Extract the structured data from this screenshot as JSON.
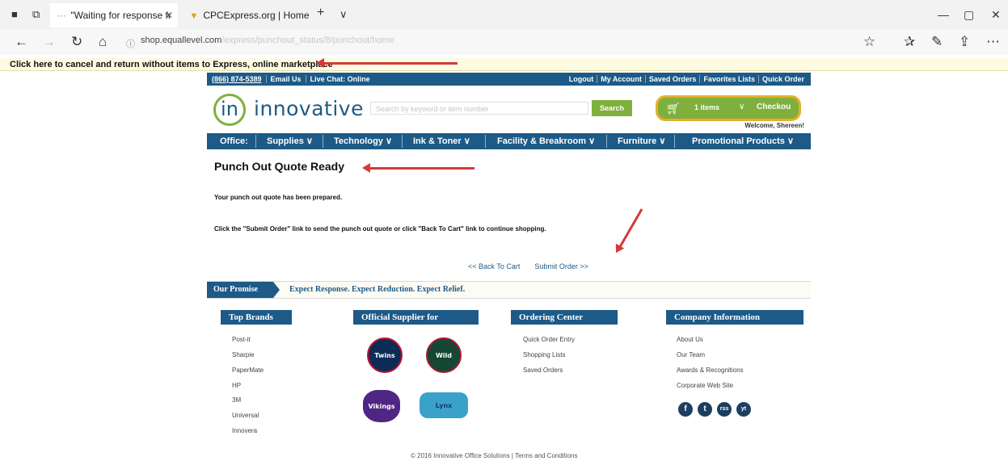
{
  "browser": {
    "tabs": [
      {
        "label": "\"Waiting for response fr",
        "active": true
      },
      {
        "label": "CPCExpress.org | Home",
        "active": false
      }
    ],
    "new_tab": "+",
    "tab_menu": "∨",
    "url_host": "shop.equallevel.com",
    "url_path": "/express/punchout_status/8/punchout/home",
    "infobar_text": "Click here to cancel and return without items to Express, online marketplace"
  },
  "site": {
    "phone": "(866) 874-5389",
    "top_left_links": [
      "Email Us",
      "Live Chat: Online"
    ],
    "top_right_links": [
      "Logout",
      "My Account",
      "Saved Orders",
      "Favorites Lists",
      "Quick Order"
    ],
    "logo_mark": "in",
    "logo_text": "innovative",
    "search_placeholder": "Search by keyword or item number",
    "search_button": "Search",
    "cart_items": "1 items",
    "checkout": "Checkou",
    "welcome": "Welcome, Shereen!",
    "main_nav": [
      "Office:",
      "Supplies ∨",
      "Technology ∨",
      "Ink & Toner ∨",
      "Facility & Breakroom ∨",
      "Furniture ∨",
      "Promotional Products ∨"
    ],
    "page_title": "Punch Out Quote Ready",
    "message1": "Your punch out quote has been prepared.",
    "message2": "Click the \"Submit Order\" link to send the punch out quote or click \"Back To Cart\" link to continue shopping.",
    "back_link": "<< Back To Cart",
    "submit_link": "Submit Order >>",
    "promise_label": "Our Promise",
    "promise_text": "Expect Response. Expect Reduction. Expect Relief.",
    "top_brands": {
      "title": "Top Brands",
      "items": [
        "Post-it",
        "Sharpie",
        "PaperMate",
        "HP",
        "3M",
        "Universal",
        "Innovera"
      ]
    },
    "official_supplier": {
      "title": "Official Supplier for",
      "logos": [
        "Twins",
        "Wild",
        "Vikings",
        "Lynx"
      ]
    },
    "ordering_center": {
      "title": "Ordering Center",
      "items": [
        "Quick Order Entry",
        "Shopping Lists",
        "Saved Orders"
      ]
    },
    "company_info": {
      "title": "Company Information",
      "items": [
        "About Us",
        "Our Team",
        "Awards & Recognitions",
        "Corporate Web Site"
      ]
    },
    "social": [
      "f",
      "t",
      "rss",
      "yt"
    ],
    "footer": "© 2016 Innovative Office Solutions  |  Terms and Conditions"
  },
  "colors": {
    "brand_blue": "#1d5a87",
    "brand_green": "#7fb03e",
    "annotation_red": "#d43a3a",
    "cart_outline": "#e5b02c"
  }
}
